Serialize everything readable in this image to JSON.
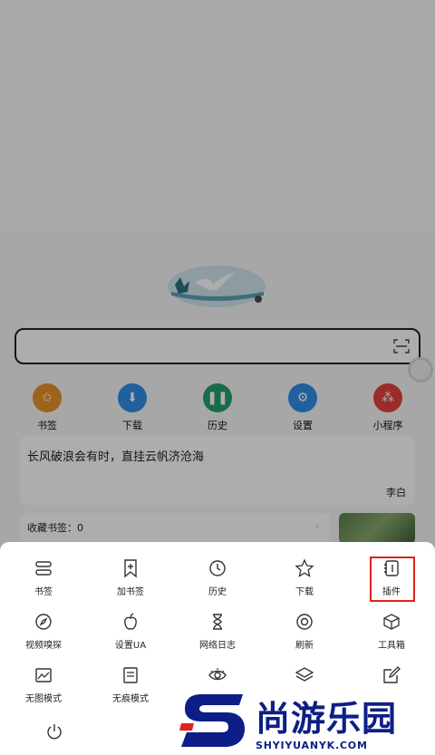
{
  "home": {
    "quick_links": [
      {
        "label": "书签",
        "icon": "star-icon",
        "color": "#e8922a"
      },
      {
        "label": "下载",
        "icon": "download-icon",
        "color": "#2f8ee8"
      },
      {
        "label": "历史",
        "icon": "footprints-icon",
        "color": "#25a06a"
      },
      {
        "label": "设置",
        "icon": "gear-icon",
        "color": "#2f8ee8"
      },
      {
        "label": "小程序",
        "icon": "mini-program-icon",
        "color": "#e3433a"
      }
    ],
    "quote": {
      "text": "长风破浪会有时，直挂云帆济沧海",
      "author": "李白"
    },
    "bookmarks_label": "收藏书签：0"
  },
  "menu": {
    "items": [
      {
        "label": "书签",
        "icon": "bookmark-list-icon"
      },
      {
        "label": "加书签",
        "icon": "add-bookmark-icon"
      },
      {
        "label": "历史",
        "icon": "clock-icon"
      },
      {
        "label": "下载",
        "icon": "star-outline-icon"
      },
      {
        "label": "插件",
        "icon": "plugin-icon"
      },
      {
        "label": "视频嗅探",
        "icon": "compass-icon"
      },
      {
        "label": "设置UA",
        "icon": "apple-icon"
      },
      {
        "label": "网络日志",
        "icon": "hourglass-icon"
      },
      {
        "label": "刷新",
        "icon": "refresh-circle-icon"
      },
      {
        "label": "工具箱",
        "icon": "toolbox-icon"
      },
      {
        "label": "无图模式",
        "icon": "image-off-icon"
      },
      {
        "label": "无痕模式",
        "icon": "document-icon"
      },
      {
        "label": "",
        "icon": "eye-icon"
      },
      {
        "label": "",
        "icon": "layers-icon"
      },
      {
        "label": "",
        "icon": "edit-icon"
      },
      {
        "label": "",
        "icon": "power-icon"
      }
    ],
    "highlight_color": "#e0231d"
  },
  "watermark": {
    "title": "尚游乐园",
    "subtitle": "SHYIYUANYK.COM",
    "color": "#0d1e86",
    "accent": "#e0231d"
  }
}
